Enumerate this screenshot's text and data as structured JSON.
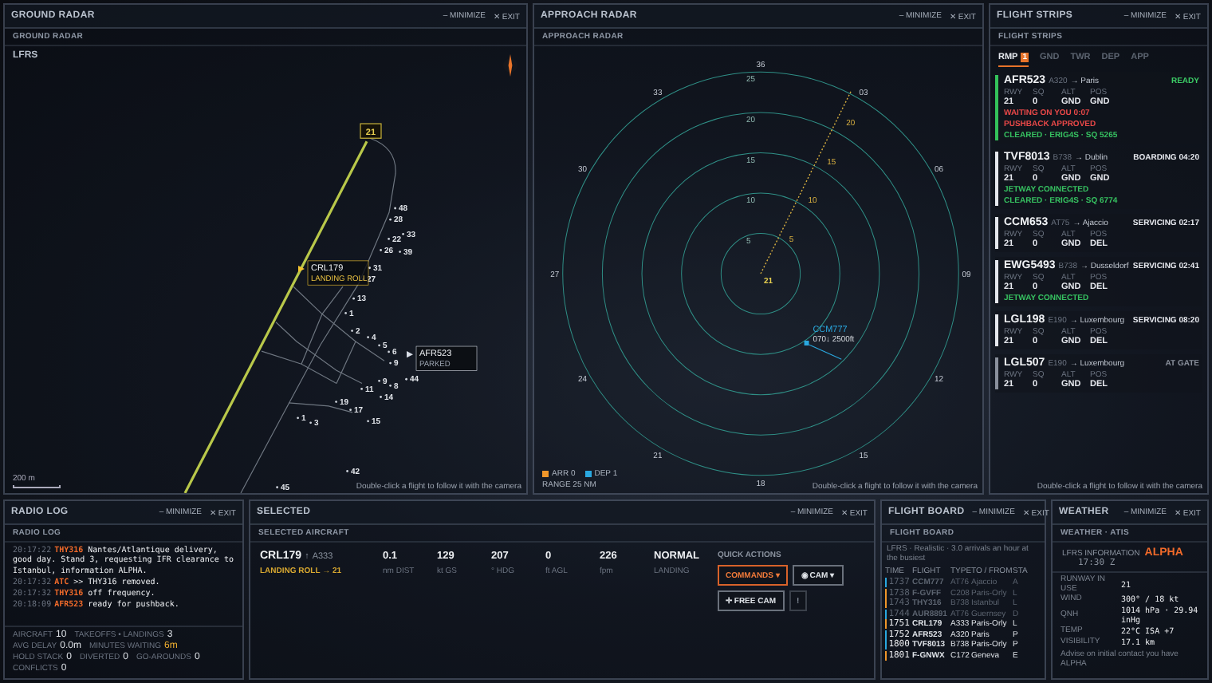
{
  "ground_radar": {
    "title": "GROUND RADAR",
    "subtitle": "GROUND RADAR",
    "minimize": "– MINIMIZE",
    "exit": "✕ EXIT",
    "airport": "LFRS",
    "runway": "21",
    "stands": [
      "48",
      "28",
      "22",
      "33",
      "26",
      "39",
      "31",
      "27",
      "13",
      "1",
      "2",
      "4",
      "5",
      "6",
      "9",
      "44",
      "9",
      "8",
      "11",
      "14",
      "19",
      "17",
      "15",
      "1",
      "3",
      "42",
      "45"
    ],
    "aircraft": [
      {
        "callsign": "CRL179",
        "status": "LANDING ROLL",
        "kind": "arrival"
      },
      {
        "callsign": "AFR523",
        "status": "PARKED",
        "kind": "departure"
      }
    ],
    "scale": "200 m",
    "hint": "Double-click a flight to follow it with the camera"
  },
  "approach_radar": {
    "title": "APPROACH RADAR",
    "subtitle": "APPROACH RADAR",
    "minimize": "– MINIMIZE",
    "exit": "✕ EXIT",
    "bearings": [
      "36",
      "03",
      "06",
      "09",
      "12",
      "15",
      "18",
      "21",
      "24",
      "27",
      "30",
      "33"
    ],
    "rings": [
      "25",
      "20",
      "15",
      "10",
      "5"
    ],
    "approach_marks": [
      "5",
      "10",
      "15",
      "20"
    ],
    "runway": "21",
    "traffic": [
      {
        "callsign": "CCM777",
        "data": "070↓ 2500ft",
        "kind": "departure"
      }
    ],
    "legend": [
      {
        "label": "ARR",
        "count": "0",
        "color": "#f0962a"
      },
      {
        "label": "DEP",
        "count": "1",
        "color": "#2aa8e0"
      }
    ],
    "range": "RANGE 25 NM",
    "hint": "Double-click a flight to follow it with the camera"
  },
  "flight_strips": {
    "title": "FLIGHT STRIPS",
    "subtitle": "FLIGHT STRIPS",
    "minimize": "– MINIMIZE",
    "exit": "✕ EXIT",
    "tabs": [
      {
        "label": "RMP",
        "badge": "1",
        "selected": true
      },
      {
        "label": "GND",
        "selected": false
      },
      {
        "label": "TWR",
        "selected": false
      },
      {
        "label": "DEP",
        "selected": false
      },
      {
        "label": "APP",
        "selected": false
      }
    ],
    "strips": [
      {
        "callsign": "AFR523",
        "type": "A320",
        "dest": "→ Paris",
        "status": "READY",
        "color": "#33c25a",
        "fields": [
          {
            "label": "RWY",
            "value": "21"
          },
          {
            "label": "SQ",
            "value": "0"
          },
          {
            "label": "ALT",
            "value": "GND"
          },
          {
            "label": "POS",
            "value": "GND"
          }
        ],
        "notes": [
          {
            "text": "WAITING ON YOU 0:07",
            "kind": "alert"
          },
          {
            "text": "PUSHBACK APPROVED",
            "kind": "alert"
          },
          {
            "text": "CLEARED · ERIG4S · SQ 5265",
            "kind": "ok"
          }
        ]
      },
      {
        "callsign": "TVF8013",
        "type": "B738",
        "dest": "→ Dublin",
        "status": "BOARDING 04:20",
        "color": "#e6e8ee",
        "fields": [
          {
            "label": "RWY",
            "value": "21"
          },
          {
            "label": "SQ",
            "value": "0"
          },
          {
            "label": "ALT",
            "value": "GND"
          },
          {
            "label": "POS",
            "value": "GND"
          }
        ],
        "notes": [
          {
            "text": "JETWAY CONNECTED",
            "kind": "ok"
          },
          {
            "text": "CLEARED · ERIG4S · SQ 6774",
            "kind": "ok"
          }
        ]
      },
      {
        "callsign": "CCM653",
        "type": "AT75",
        "dest": "→ Ajaccio",
        "status": "SERVICING 02:17",
        "color": "#e6e8ee",
        "fields": [
          {
            "label": "RWY",
            "value": "21"
          },
          {
            "label": "SQ",
            "value": "0"
          },
          {
            "label": "ALT",
            "value": "GND"
          },
          {
            "label": "POS",
            "value": "DEL"
          }
        ]
      },
      {
        "callsign": "EWG5493",
        "type": "B738",
        "dest": "→ Dusseldorf",
        "status": "SERVICING 02:41",
        "color": "#e6e8ee",
        "fields": [
          {
            "label": "RWY",
            "value": "21"
          },
          {
            "label": "SQ",
            "value": "0"
          },
          {
            "label": "ALT",
            "value": "GND"
          },
          {
            "label": "POS",
            "value": "DEL"
          }
        ],
        "notes": [
          {
            "text": "JETWAY CONNECTED",
            "kind": "ok"
          }
        ]
      },
      {
        "callsign": "LGL198",
        "type": "E190",
        "dest": "→ Luxembourg",
        "status": "SERVICING 08:20",
        "color": "#e6e8ee",
        "fields": [
          {
            "label": "RWY",
            "value": "21"
          },
          {
            "label": "SQ",
            "value": "0"
          },
          {
            "label": "ALT",
            "value": "GND"
          },
          {
            "label": "POS",
            "value": "DEL"
          }
        ]
      },
      {
        "callsign": "LGL507",
        "type": "E190",
        "dest": "→ Luxembourg",
        "status": "AT GATE",
        "color": "#8a909c",
        "fields": [
          {
            "label": "RWY",
            "value": "21"
          },
          {
            "label": "SQ",
            "value": "0"
          },
          {
            "label": "ALT",
            "value": "GND"
          },
          {
            "label": "POS",
            "value": "DEL"
          }
        ]
      }
    ],
    "hint": "Double-click a flight to follow it with the camera"
  },
  "radio_log": {
    "title": "RADIO LOG",
    "subtitle": "RADIO LOG",
    "minimize": "– MINIMIZE",
    "exit": "✕ EXIT",
    "messages": [
      {
        "time": "20:17:22",
        "sender": "THY316",
        "text": "Nantes/Atlantique delivery, good day. Stand 3, requesting IFR clearance to Istanbul, information ALPHA."
      },
      {
        "time": "20:17:32",
        "sender": "ATC",
        "text": ">> THY316 removed."
      },
      {
        "time": "20:17:32",
        "sender": "THY316",
        "text": "off frequency."
      },
      {
        "time": "20:18:09",
        "sender": "AFR523",
        "text": "ready for pushback."
      }
    ],
    "stats": [
      {
        "label": "AIRCRAFT",
        "value": "10",
        "highlight": false
      },
      {
        "label": "TAKEOFFS • LANDINGS",
        "value": "3",
        "highlight": false
      },
      {
        "label": "AVG DELAY",
        "value": "0.0m",
        "highlight": false
      },
      {
        "label": "MINUTES WAITING",
        "value": "6m",
        "highlight": true
      },
      {
        "label": "HOLD STACK",
        "value": "0",
        "highlight": false
      },
      {
        "label": "DIVERTED",
        "value": "0",
        "highlight": false
      },
      {
        "label": "GO-AROUNDS",
        "value": "0",
        "highlight": false
      },
      {
        "label": "CONFLICTS",
        "value": "0",
        "highlight": false
      }
    ]
  },
  "selected": {
    "title": "SELECTED",
    "subtitle": "SELECTED AIRCRAFT",
    "minimize": "– MINIMIZE",
    "exit": "✕ EXIT",
    "callsign": "CRL179",
    "arrow": "↑",
    "type": "A333",
    "phase": "LANDING ROLL → 21",
    "stats": [
      {
        "value": "0.1",
        "label": "nm DIST"
      },
      {
        "value": "129",
        "label": "kt GS"
      },
      {
        "value": "207",
        "label": "° HDG"
      },
      {
        "value": "0",
        "label": "ft AGL"
      },
      {
        "value": "226",
        "label": "fpm"
      },
      {
        "value": "NORMAL",
        "label": "LANDING"
      }
    ],
    "quick_actions": "QUICK ACTIONS",
    "actions": [
      {
        "label": "COMMANDS ▾",
        "kind": "primary"
      },
      {
        "label": "◉ CAM ▾",
        "kind": "secondary"
      },
      {
        "label": "✛ FREE CAM",
        "kind": "secondary"
      },
      {
        "label": "!",
        "kind": "muted"
      }
    ]
  },
  "flight_board": {
    "title": "FLIGHT BOARD",
    "subtitle": "FLIGHT BOARD",
    "minimize": "– MINIMIZE",
    "exit": "✕ EXIT",
    "info": "LFRS · Realistic · 3.0 arrivals an hour at the busiest",
    "columns": [
      "TIME",
      "FLIGHT",
      "TYPE",
      "TO / FROM",
      "STA"
    ],
    "rows": [
      {
        "time": "1737",
        "flight": "CCM777",
        "type": "AT76",
        "place": "Ajaccio",
        "status": "A",
        "color": "#2aa8e0",
        "dimmed": true
      },
      {
        "time": "1738",
        "flight": "F-GVFF",
        "type": "C208",
        "place": "Paris-Orly",
        "status": "L",
        "color": "#f0962a",
        "dimmed": true
      },
      {
        "time": "1743",
        "flight": "THY316",
        "type": "B738",
        "place": "Istanbul",
        "status": "L",
        "color": "#f0962a",
        "dimmed": true
      },
      {
        "time": "1744",
        "flight": "AUR8891",
        "type": "AT76",
        "place": "Guernsey",
        "status": "D",
        "color": "#2aa8e0",
        "dimmed": true
      },
      {
        "time": "1751",
        "flight": "CRL179",
        "type": "A333",
        "place": "Paris-Orly",
        "status": "L",
        "color": "#f0962a",
        "dimmed": false
      },
      {
        "time": "1752",
        "flight": "AFR523",
        "type": "A320",
        "place": "Paris",
        "status": "P",
        "color": "#2aa8e0",
        "dimmed": false
      },
      {
        "time": "1800",
        "flight": "TVF8013",
        "type": "B738",
        "place": "Paris-Orly",
        "status": "P",
        "color": "#2aa8e0",
        "dimmed": false
      },
      {
        "time": "1801",
        "flight": "F-GNWX",
        "type": "C172",
        "place": "Geneva",
        "status": "E",
        "color": "#f0962a",
        "dimmed": false
      }
    ]
  },
  "weather": {
    "title": "WEATHER",
    "subtitle": "WEATHER · ATIS",
    "minimize": "– MINIMIZE",
    "exit": "✕ EXIT",
    "info_label": "LFRS INFORMATION",
    "info_letter": "ALPHA",
    "time": "17:30 Z",
    "rows": [
      {
        "label": "RUNWAY IN USE",
        "value": "21"
      },
      {
        "label": "WIND",
        "value": "300° / 18 kt"
      },
      {
        "label": "QNH",
        "value": "1014 hPa · 29.94 inHg"
      },
      {
        "label": "TEMP",
        "value": "22°C  ISA +7"
      },
      {
        "label": "VISIBILITY",
        "value": "17.1 km"
      }
    ],
    "note": "Advise on initial contact you have ALPHA"
  }
}
